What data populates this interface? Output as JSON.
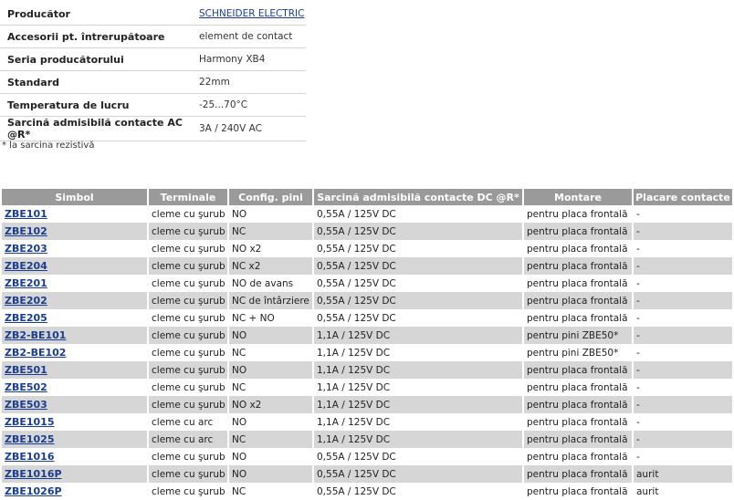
{
  "specs": [
    {
      "label": "Producător",
      "value": "SCHNEIDER ELECTRIC",
      "link": true
    },
    {
      "label": "Accesorii pt. întrerupătoare",
      "value": "element de contact"
    },
    {
      "label": "Seria producătorului",
      "value": "Harmony XB4"
    },
    {
      "label": "Standard",
      "value": "22mm"
    },
    {
      "label": "Temperatura de lucru",
      "value": "-25...70°C"
    },
    {
      "label": "Sarcină admisibilă contacte AC @R*",
      "value": "3A / 240V AC"
    }
  ],
  "note": "* la sarcina rezistivă",
  "table": {
    "headers": [
      "Simbol",
      "Terminale",
      "Config. pini",
      "Sarcină admisibilă contacte DC @R*",
      "Montare",
      "Placare contacte"
    ],
    "rows": [
      [
        "ZBE101",
        "cleme cu şurub",
        "NO",
        "0,55A / 125V DC",
        "pentru placa frontală",
        "-"
      ],
      [
        "ZBE102",
        "cleme cu şurub",
        "NC",
        "0,55A / 125V DC",
        "pentru placa frontală",
        "-"
      ],
      [
        "ZBE203",
        "cleme cu şurub",
        "NO x2",
        "0,55A / 125V DC",
        "pentru placa frontală",
        "-"
      ],
      [
        "ZBE204",
        "cleme cu şurub",
        "NC x2",
        "0,55A / 125V DC",
        "pentru placa frontală",
        "-"
      ],
      [
        "ZBE201",
        "cleme cu şurub",
        "NO de avans",
        "0,55A / 125V DC",
        "pentru placa frontală",
        "-"
      ],
      [
        "ZBE202",
        "cleme cu şurub",
        "NC de întârziere",
        "0,55A / 125V DC",
        "pentru placa frontală",
        "-"
      ],
      [
        "ZBE205",
        "cleme cu şurub",
        "NC + NO",
        "0,55A / 125V DC",
        "pentru placa frontală",
        "-"
      ],
      [
        "ZB2-BE101",
        "cleme cu şurub",
        "NO",
        "1,1A / 125V DC",
        "pentru pini ZBE50*",
        "-"
      ],
      [
        "ZB2-BE102",
        "cleme cu şurub",
        "NC",
        "1,1A / 125V DC",
        "pentru pini ZBE50*",
        "-"
      ],
      [
        "ZBE501",
        "cleme cu şurub",
        "NO",
        "1,1A / 125V DC",
        "pentru placa frontală",
        "-"
      ],
      [
        "ZBE502",
        "cleme cu şurub",
        "NC",
        "1,1A / 125V DC",
        "pentru placa frontală",
        "-"
      ],
      [
        "ZBE503",
        "cleme cu şurub",
        "NO x2",
        "1,1A / 125V DC",
        "pentru placa frontală",
        "-"
      ],
      [
        "ZBE1015",
        "cleme cu arc",
        "NO",
        "1,1A / 125V DC",
        "pentru placa frontală",
        "-"
      ],
      [
        "ZBE1025",
        "cleme cu arc",
        "NC",
        "1,1A / 125V DC",
        "pentru placa frontală",
        "-"
      ],
      [
        "ZBE1016",
        "cleme cu şurub",
        "NO",
        "0,55A / 125V DC",
        "pentru placa frontală",
        "-"
      ],
      [
        "ZBE1016P",
        "cleme cu şurub",
        "NO",
        "0,55A / 125V DC",
        "pentru placa frontală",
        "aurit"
      ],
      [
        "ZBE1026P",
        "cleme cu şurub",
        "NC",
        "0,55A / 125V DC",
        "pentru placa frontală",
        "aurit"
      ]
    ]
  }
}
